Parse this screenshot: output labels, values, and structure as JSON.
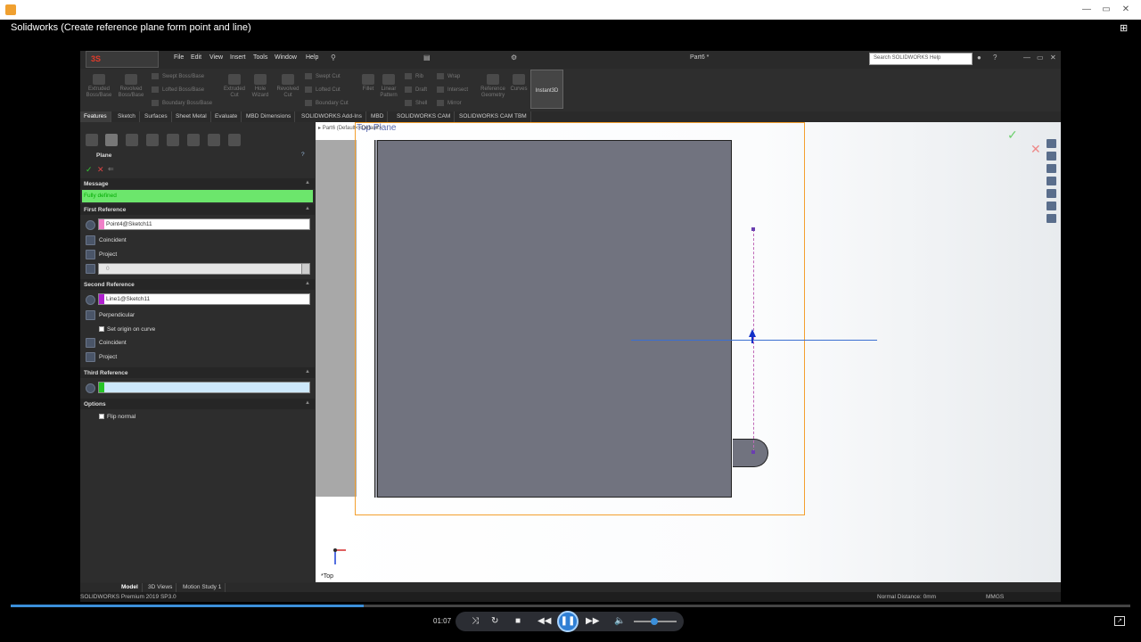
{
  "window": {
    "title": "Solidworks (Create reference plane form point and line)"
  },
  "menu": {
    "items": [
      "File",
      "Edit",
      "View",
      "Insert",
      "Tools",
      "Window",
      "Help"
    ],
    "doc_title": "Part6 *",
    "search_placeholder": "Search SOLIDWORKS Help"
  },
  "ribbon": {
    "extruded_boss": "Extruded Boss/Base",
    "revolved_boss": "Revolved Boss/Base",
    "swept_boss": "Swept Boss/Base",
    "lofted_boss": "Lofted Boss/Base",
    "boundary_boss": "Boundary Boss/Base",
    "extruded_cut": "Extruded Cut",
    "hole_wizard": "Hole Wizard",
    "revolved_cut": "Revolved Cut",
    "swept_cut": "Swept Cut",
    "lofted_cut": "Lofted Cut",
    "boundary_cut": "Boundary Cut",
    "fillet": "Fillet",
    "linear_pattern": "Linear Pattern",
    "rib": "Rib",
    "draft": "Draft",
    "shell": "Shell",
    "wrap": "Wrap",
    "intersect": "Intersect",
    "mirror": "Mirror",
    "reference_geometry": "Reference Geometry",
    "curves": "Curves",
    "instant3d": "Instant3D"
  },
  "cm_tabs": [
    "Features",
    "Sketch",
    "Surfaces",
    "Sheet Metal",
    "Evaluate",
    "MBD Dimensions",
    "SOLIDWORKS Add-Ins",
    "MBD",
    "SOLIDWORKS CAM",
    "SOLIDWORKS CAM TBM"
  ],
  "pm": {
    "title": "Plane",
    "message_head": "Message",
    "message": "Fully defined",
    "first_ref_head": "First Reference",
    "first_ref_value": "Point4@Sketch11",
    "first_ref_opt1": "Coincident",
    "first_ref_opt2": "Project",
    "first_ref_offset": "0",
    "second_ref_head": "Second Reference",
    "second_ref_value": "Line1@Sketch11",
    "second_ref_opt1": "Perpendicular",
    "second_ref_opt2": "Set origin on curve",
    "second_ref_opt3": "Coincident",
    "second_ref_opt4": "Project",
    "third_ref_head": "Third Reference",
    "options_head": "Options",
    "flip_normal": "Flip normal"
  },
  "viewport": {
    "plane_label": "Top Plane",
    "tree_flyout": "Part6 (Default<<Default>",
    "view_name": "*Top"
  },
  "bottom_tabs": [
    "Model",
    "3D Views",
    "Motion Study 1"
  ],
  "status": {
    "product": "SOLIDWORKS Premium 2019 SP3.0",
    "normal_distance": "Normal Distance: 0mm",
    "units": "MMGS"
  },
  "player": {
    "time": "01:07",
    "progress_fraction": 0.315
  },
  "colors": {
    "plane_frame": "#f3a02f",
    "message_bg": "#6ce66c",
    "line_blue": "#3b6fd1"
  }
}
